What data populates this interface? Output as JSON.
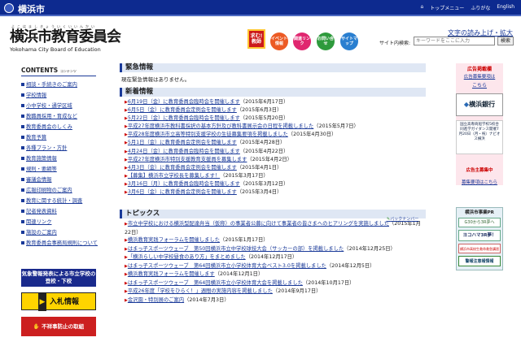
{
  "header": {
    "city": "横浜市",
    "links": [
      "トップメニュー",
      "ふりがな",
      "English"
    ]
  },
  "logo": {
    "ruby": "よこはましきょういくいいんかい",
    "jp": "横浜市教育委員会",
    "en": "Yokohama City Board of Education"
  },
  "kyujin": "求む!教師",
  "icons": [
    {
      "label": "イベント情報",
      "color": "#ec5a24"
    },
    {
      "label": "関連リンク",
      "color": "#e0266f"
    },
    {
      "label": "お問い合せ",
      "color": "#2e9a3c"
    },
    {
      "label": "サイトマップ",
      "color": "#2a7fd0"
    }
  ],
  "textsize": "文字の読み上げ・拡大",
  "search": {
    "label": "サイト内検索:",
    "placeholder": "キーワードをここに入力",
    "button": "検索"
  },
  "sidebar": {
    "title": "CONTENTS",
    "title_sub": "コンテンツ",
    "items": [
      "相談・手続きのご案内",
      "学校情報",
      "小中学校・通学区域",
      "教職員採用・育成など",
      "教育委員会のしくみ",
      "教育予算",
      "各種プラン・方針",
      "教育施策情報",
      "規則・要綱等",
      "審議会情報",
      "広報印刷物のご案内",
      "教育に関する統計・調査",
      "記者発表資料",
      "関連リンク",
      "施設のご案内",
      "教育委員会事務局規則について"
    ]
  },
  "side_banners": {
    "weather": "気象警報発表による市立学校の登校・下校",
    "nyusatsu": "入札情報",
    "fusei": "不祥事防止の取組"
  },
  "emergency": {
    "title": "緊急情報",
    "text": "現在緊急情報はありません。"
  },
  "news": {
    "title": "新着情報",
    "items": [
      {
        "t": "6月19日（金）に教育委員会臨時会を開催します",
        "d": "（2015年6月17日）"
      },
      {
        "t": "6月5日（金）に教育委員会定例会を開催します",
        "d": "（2015年6月3日）"
      },
      {
        "t": "5月22日（金）に教育委員会臨時会を開催します",
        "d": "（2015年5月20日）"
      },
      {
        "t": "平成27年度横浜市教科書採択の基本方針及び教科書展示会の日程を掲載しました",
        "d": "（2015年5月7日）"
      },
      {
        "t": "平成28年度横浜市立高等特別支援学校の生徒募集要項を掲載しました",
        "d": "（2015年4月30日）"
      },
      {
        "t": "5月1日（金）に教育委員会定例会を開催します",
        "d": "（2015年4月28日）"
      },
      {
        "t": "4月24日（金）に教育委員会臨時会を開催します",
        "d": "（2015年4月22日）"
      },
      {
        "t": "平成27年度横浜市特別支援教育支援員を募集します",
        "d": "（2015年4月2日）"
      },
      {
        "t": "4月3日（金）に教育委員会定例会を開催します",
        "d": "（2015年4月1日）"
      },
      {
        "t": "【募集】横浜市立学校長を募集します！",
        "d": "（2015年3月17日）"
      },
      {
        "t": "3月16日（月）に教育委員会臨時会を開催します",
        "d": "（2015年3月12日）"
      },
      {
        "t": "3月6日（金）に教育委員会定例会を開催します",
        "d": "（2015年3月4日）"
      }
    ],
    "backnumber": "バックナンバー"
  },
  "topics": {
    "title": "トピックス",
    "items": [
      {
        "t": "市立中学校における横浜型配達弁当（仮称）の事業者公募に向けて事業者の皆さまへのヒアリングを実施しました",
        "d": "（2015年1月22日）"
      },
      {
        "t": "横浜教育実践フォーラムを開催しました",
        "d": "（2015年1月17日）"
      },
      {
        "t": "はまっ子スポーツウェーブ　第50回横浜市立中学校球技大会（サッカーの部）を掲載しました",
        "d": "（2014年12月25日）"
      },
      {
        "t": "「横浜らしい中学校昼食のあり方」をまとめました",
        "d": "（2014年12月17日）"
      },
      {
        "t": "はまっ子スポーツウェーブ　第64回横浜市立小学校体育大会ベスト3.0を掲載しました",
        "d": "（2014年12月5日）"
      },
      {
        "t": "横浜教育実践フォーラムを開催します",
        "d": "（2014年12月1日）"
      },
      {
        "t": "はまっ子スポーツウェーブ　第64回横浜市立小学校体育大会を掲載しました",
        "d": "（2014年10月17日）"
      },
      {
        "t": "平成26年度「学校をひらく！」週間の実施内容を掲載しました",
        "d": "（2014年9月17日）"
      },
      {
        "t": "金沢園・特別展のご案内",
        "d": "（2014年7月3日）"
      }
    ]
  },
  "right": {
    "ad_title": "広告掲載欄",
    "ad_link": "広告募集要項は",
    "ad_here": "こちら",
    "bank": "横浜銀行",
    "adtext": "国立高専商船学校5校合同進学ガイダンス開催7月20日（月・祝）ナビオス横浜",
    "recruit": "広告主募集中",
    "recruit_link": "募集要項はこちら",
    "pr": "横浜市事業PR",
    "pr1": "G30から3R夢へ",
    "pr2": "ヨコハマ3R夢！",
    "pr3": "横浜市高校生救命救急講習会",
    "pr4": "警報注意報情報"
  }
}
